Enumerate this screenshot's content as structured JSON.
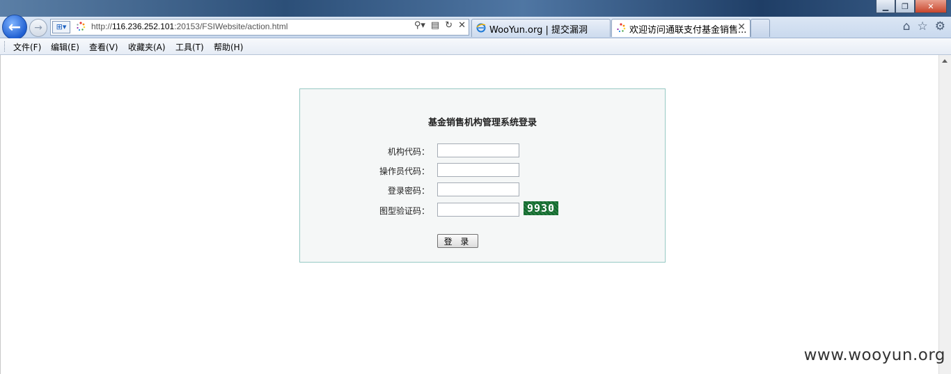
{
  "browser": {
    "address": {
      "url_prefix": "http://",
      "url_host": "116.236.252.101",
      "url_rest": ":20153/FSIWebsite/action.html"
    },
    "tabs": [
      {
        "label": "WooYun.org | 提交漏洞"
      },
      {
        "label": "欢迎访问通联支付基金销售..."
      }
    ],
    "menu": [
      "文件(F)",
      "编辑(E)",
      "查看(V)",
      "收藏夹(A)",
      "工具(T)",
      "帮助(H)"
    ]
  },
  "login": {
    "title": "基金销售机构管理系统登录",
    "fields": [
      {
        "label": "机构代码：",
        "value": ""
      },
      {
        "label": "操作员代码：",
        "value": ""
      },
      {
        "label": "登录密码：",
        "value": ""
      },
      {
        "label": "图型验证码：",
        "value": ""
      }
    ],
    "captcha_text": "9930",
    "submit_label": "登 录"
  },
  "watermark": "www.wooyun.org",
  "colors": {
    "login_box_bg": "#f5f7f7",
    "login_box_border": "#97c9c4",
    "captcha_bg": "#0f6a2b",
    "ie_blue": "#1f5fd1"
  },
  "icons": [
    "back-arrow-icon",
    "forward-arrow-icon",
    "compat-view-icon",
    "loading-icon",
    "search-icon",
    "refresh-icon",
    "stop-icon",
    "ie-icon",
    "home-icon",
    "favorites-star-icon",
    "gear-icon"
  ]
}
